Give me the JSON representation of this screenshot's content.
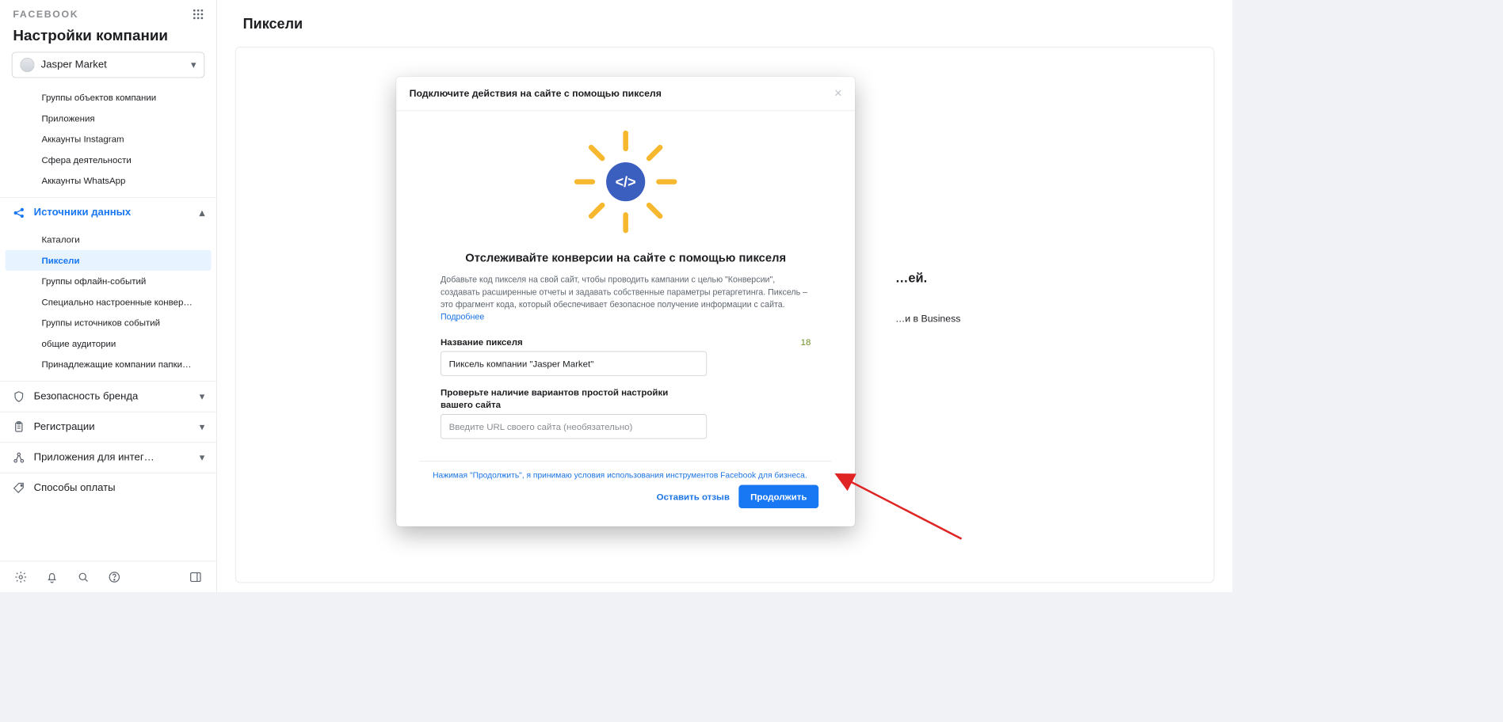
{
  "brand": "FACEBOOK",
  "settings_title": "Настройки компании",
  "company": {
    "name": "Jasper Market"
  },
  "page_title": "Пиксели",
  "sidebar": {
    "top_items": [
      "Группы объектов компании",
      "Приложения",
      "Аккаунты Instagram",
      "Сфера деятельности",
      "Аккаунты WhatsApp"
    ],
    "data_sources": {
      "label": "Источники данных",
      "items": [
        "Каталоги",
        "Пиксели",
        "Группы офлайн-событий",
        "Специально настроенные конвер…",
        "Группы источников событий",
        "общие аудитории",
        "Принадлежащие компании папки…"
      ]
    },
    "cats": [
      "Безопасность бренда",
      "Регистрации",
      "Приложения для интег…",
      "Способы оплаты"
    ]
  },
  "behind_modal": {
    "h": "…ей.",
    "p": "…и в Business"
  },
  "modal": {
    "title": "Подключите действия на сайте с помощью пикселя",
    "h2": "Отслеживайте конверсии на сайте с помощью пикселя",
    "desc": "Добавьте код пикселя на свой сайт, чтобы проводить кампании с целью \"Конверсии\", создавать расширенные отчеты и задавать собственные параметры ретаргетинга. Пиксель – это фрагмент кода, который обеспечивает безопасное получение информации с сайта.",
    "learn_more": "Подробнее",
    "name_label": "Название пикселя",
    "name_counter": "18",
    "name_value": "Пиксель компании \"Jasper Market\"",
    "url_label": "Проверьте наличие вариантов простой настройки вашего сайта",
    "url_placeholder": "Введите URL своего сайта (необязательно)",
    "terms": "Нажимая \"Продолжить\", я принимаю условия использования инструментов Facebook для бизнеса.",
    "feedback": "Оставить отзыв",
    "continue": "Продолжить"
  }
}
